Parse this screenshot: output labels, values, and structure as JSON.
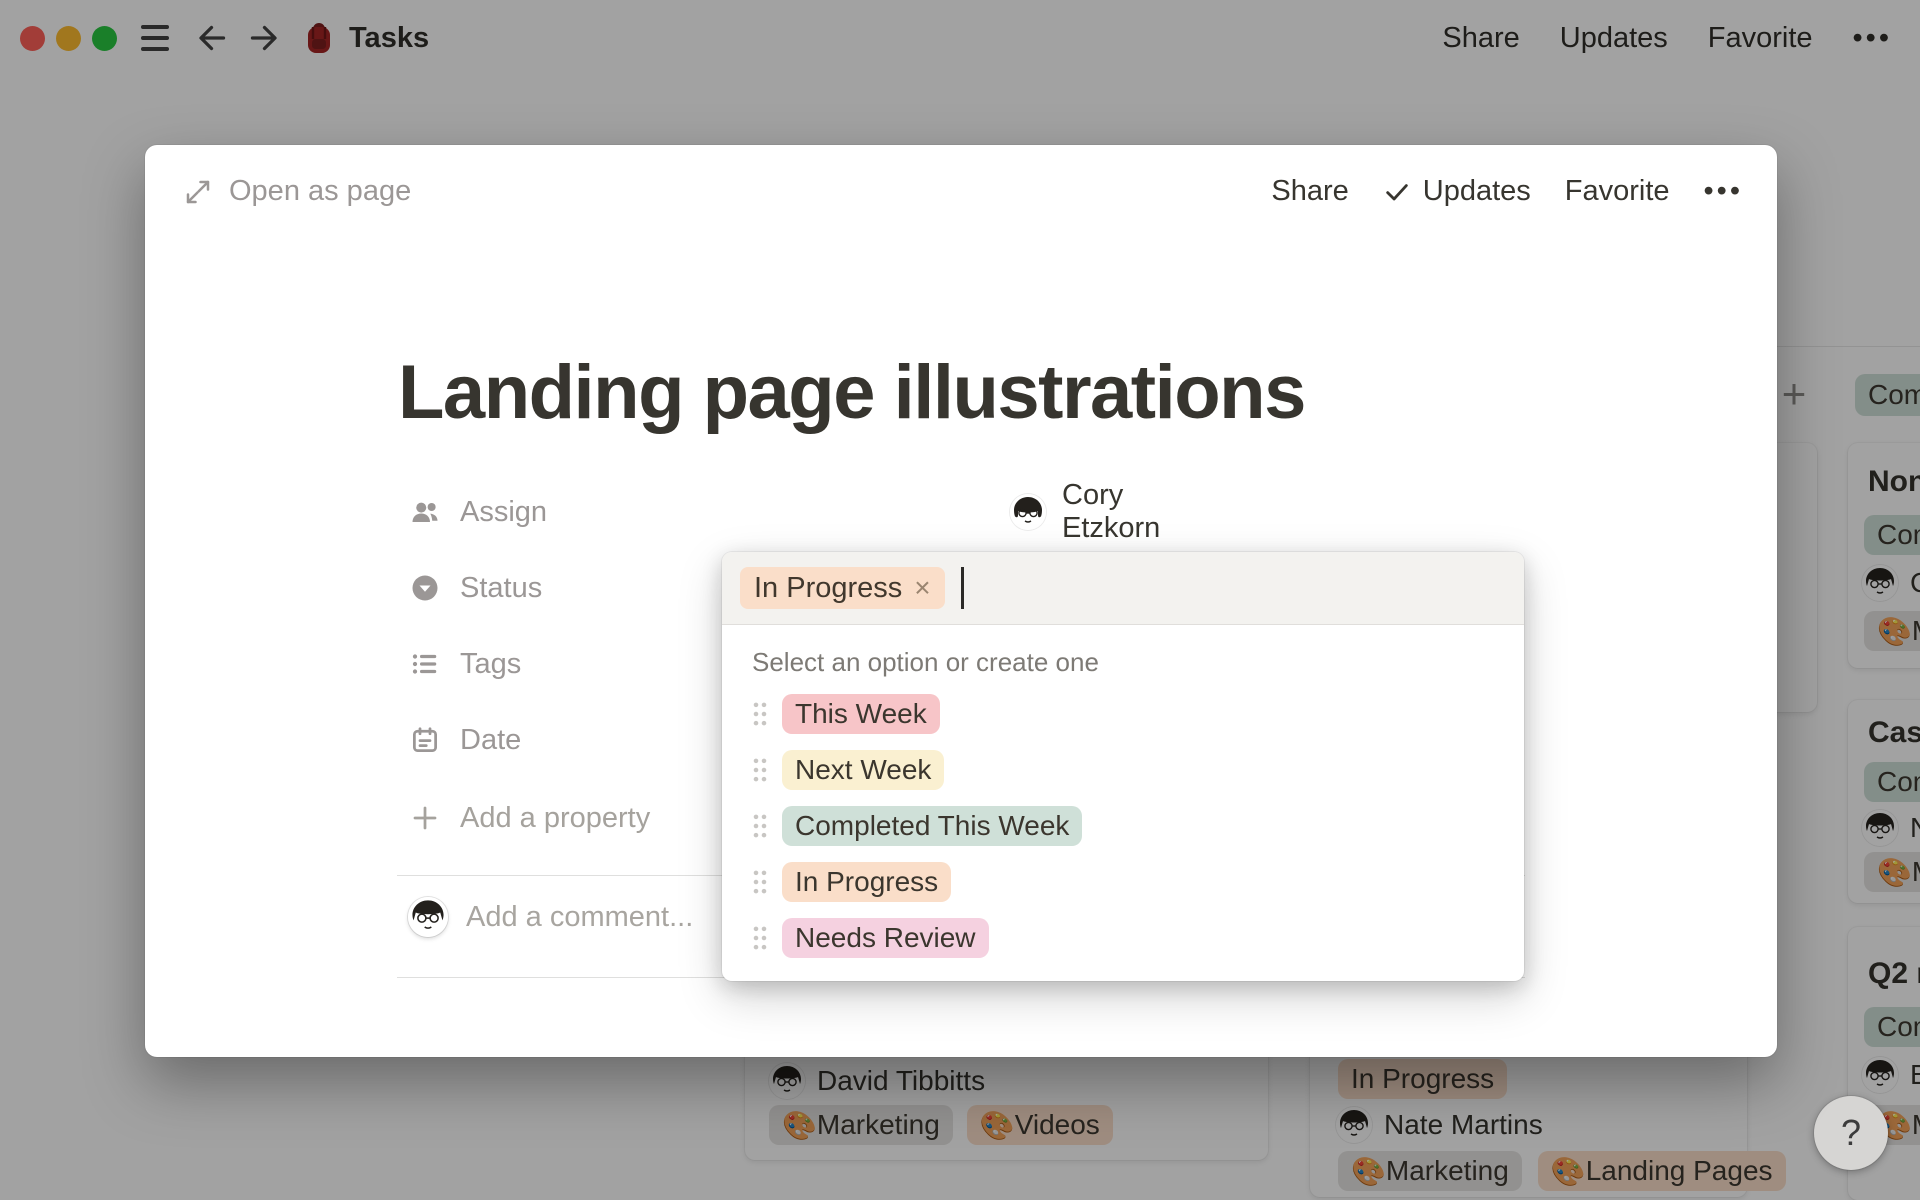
{
  "titlebar": {
    "page_icon": "🎒",
    "title": "Tasks",
    "actions": {
      "share": "Share",
      "updates": "Updates",
      "favorite": "Favorite",
      "more": "•••"
    }
  },
  "modal": {
    "open_as_page": "Open as page",
    "actions": {
      "share": "Share",
      "updates": "Updates",
      "favorite": "Favorite",
      "more": "•••"
    }
  },
  "page": {
    "title": "Landing page illustrations",
    "properties": {
      "assign": {
        "label": "Assign",
        "value": "Cory Etzkorn"
      },
      "status": {
        "label": "Status"
      },
      "tags": {
        "label": "Tags"
      },
      "date": {
        "label": "Date"
      }
    },
    "add_property": "Add a property",
    "comment_placeholder": "Add a comment..."
  },
  "status_dropdown": {
    "selected": {
      "label": "In Progress",
      "remove": "×",
      "color": "#fadec9"
    },
    "hint": "Select an option or create one",
    "options": [
      {
        "label": "This Week",
        "color": "#f7c5c8"
      },
      {
        "label": "Next Week",
        "color": "#faf0d1"
      },
      {
        "label": "Completed This Week",
        "color": "#cfe0d8"
      },
      {
        "label": "In Progress",
        "color": "#fadec9"
      },
      {
        "label": "Needs Review",
        "color": "#f5d1e0"
      }
    ]
  },
  "board": {
    "add_button": "+",
    "column_header": {
      "label": "Com",
      "color": "#cfe0d8"
    },
    "right_cards": [
      {
        "title": "Non",
        "status": {
          "label": "Com",
          "color": "#cfe0d8"
        },
        "person": "C",
        "tag": {
          "emoji": "🎨",
          "label": "M",
          "color": "#e6e5e2"
        }
      },
      {
        "title": "Cas",
        "status": {
          "label": "Com",
          "color": "#cfe0d8"
        },
        "person": "N",
        "tag": {
          "emoji": "🎨",
          "label": "M",
          "color": "#e6e5e2"
        }
      },
      {
        "title": "Q2 r",
        "status": {
          "label": "Com",
          "color": "#cfe0d8"
        },
        "person": "B",
        "tag": {
          "emoji": "🎨",
          "label": "M",
          "color": "#e6e5e2"
        }
      }
    ],
    "bottom_cards": {
      "david": {
        "person": "David Tibbitts",
        "tags": [
          {
            "emoji": "🎨",
            "label": "Marketing",
            "color": "#e6e5e2"
          },
          {
            "emoji": "🎨",
            "label": "Videos",
            "color": "#fadec9"
          }
        ]
      },
      "nate": {
        "status": {
          "label": "In Progress",
          "color": "#fadec9"
        },
        "person": "Nate Martins",
        "tags": [
          {
            "emoji": "🎨",
            "label": "Marketing",
            "color": "#e6e5e2"
          },
          {
            "emoji": "🎨",
            "label": "Landing Pages",
            "color": "#fadec9"
          }
        ]
      }
    },
    "help_button": "?"
  }
}
